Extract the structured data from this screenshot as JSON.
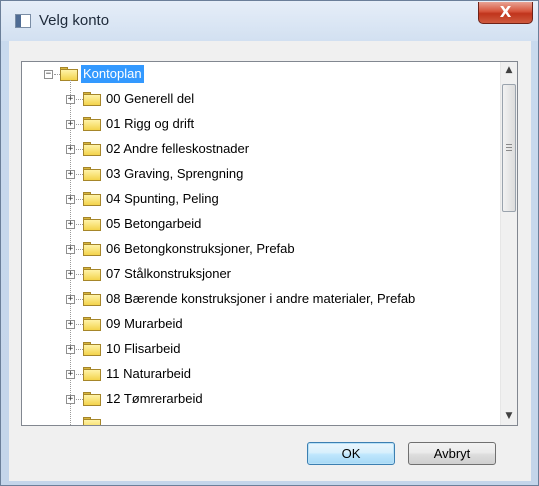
{
  "window": {
    "title": "Velg konto",
    "close_glyph": "X"
  },
  "tree": {
    "root": {
      "label": "Kontoplan",
      "expander": "−",
      "selected": true
    },
    "items": [
      {
        "label": "00 Generell del",
        "expander": "+"
      },
      {
        "label": "01 Rigg og drift",
        "expander": "+"
      },
      {
        "label": "02 Andre felleskostnader",
        "expander": "+"
      },
      {
        "label": "03 Graving, Sprengning",
        "expander": "+"
      },
      {
        "label": "04 Spunting, Peling",
        "expander": "+"
      },
      {
        "label": "05 Betongarbeid",
        "expander": "+"
      },
      {
        "label": "06 Betongkonstruksjoner, Prefab",
        "expander": "+"
      },
      {
        "label": "07 Stålkonstruksjoner",
        "expander": "+"
      },
      {
        "label": "08 Bærende konstruksjoner i andre materialer, Prefab",
        "expander": "+"
      },
      {
        "label": "09 Murarbeid",
        "expander": "+"
      },
      {
        "label": "10 Flisarbeid",
        "expander": "+"
      },
      {
        "label": "11 Naturarbeid",
        "expander": "+"
      },
      {
        "label": "12 Tømrerarbeid",
        "expander": "+"
      }
    ],
    "scroll": {
      "up_glyph": "▲",
      "down_glyph": "▼"
    }
  },
  "buttons": {
    "ok": "OK",
    "cancel": "Avbryt"
  },
  "colors": {
    "selection": "#3399ff",
    "folder": "#f3d34b",
    "close_button": "#c0341c"
  }
}
